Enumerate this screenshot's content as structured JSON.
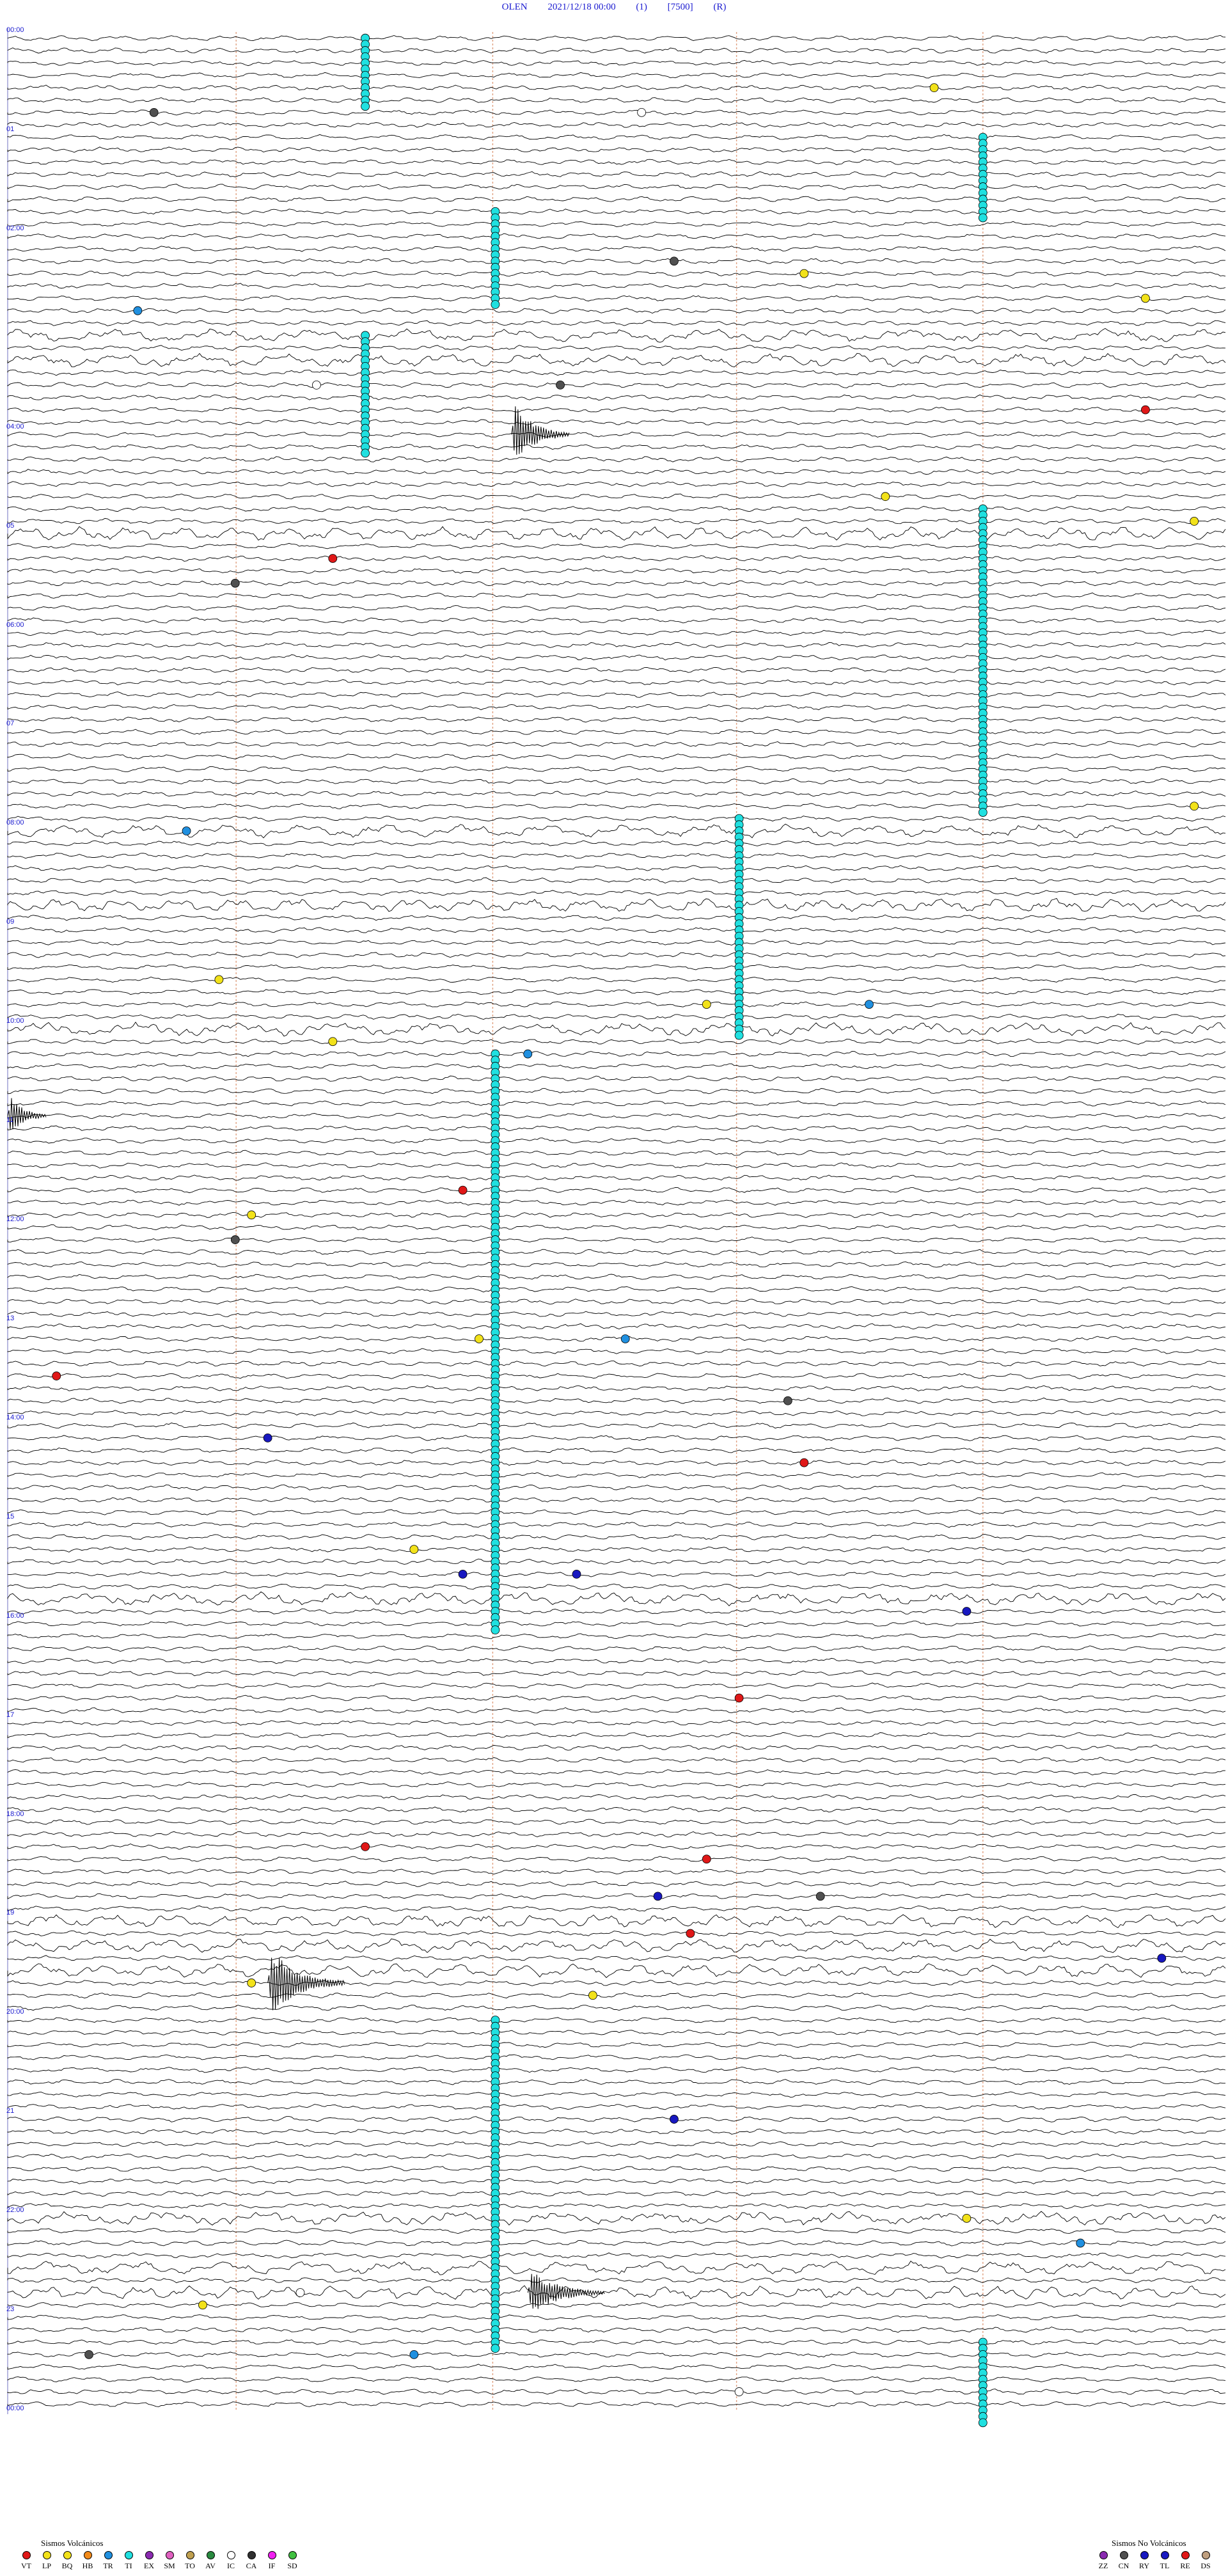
{
  "header": {
    "station": "OLEN",
    "datetime": "2021/12/18 00:00",
    "channel": "(1)",
    "gain": "[7500]",
    "flag": "(R)"
  },
  "legend_volcanic": {
    "title": "Sismos Volcánicos",
    "items": [
      {
        "code": "VT",
        "color": "#e01818"
      },
      {
        "code": "LP",
        "color": "#f2e21a"
      },
      {
        "code": "BQ",
        "color": "#f2e21a"
      },
      {
        "code": "HB",
        "color": "#f28a1a"
      },
      {
        "code": "TR",
        "color": "#2090e0"
      },
      {
        "code": "TI",
        "color": "#20e0e0"
      },
      {
        "code": "EX",
        "color": "#8a2ab0"
      },
      {
        "code": "SM",
        "color": "#e060c0"
      },
      {
        "code": "TO",
        "color": "#c0a050"
      },
      {
        "code": "AV",
        "color": "#2a8a40"
      },
      {
        "code": "IC",
        "color": "#ffffff"
      },
      {
        "code": "CA",
        "color": "#303030"
      },
      {
        "code": "IF",
        "color": "#f020f0"
      },
      {
        "code": "SD",
        "color": "#40c040"
      }
    ]
  },
  "legend_non_volcanic": {
    "title": "Sismos No Volcánicos",
    "items": [
      {
        "code": "ZZ",
        "color": "#8a2ab0"
      },
      {
        "code": "CN",
        "color": "#505050"
      },
      {
        "code": "RY",
        "color": "#1818c0"
      },
      {
        "code": "TL",
        "color": "#1818c0"
      },
      {
        "code": "RE",
        "color": "#e01818"
      },
      {
        "code": "DS",
        "color": "#c0a080"
      }
    ]
  },
  "chart_data": {
    "type": "line",
    "title": "OLEN 2021/12/18 00:00 (1) [7500] (R)",
    "time_labels": [
      {
        "row": 0,
        "label": "00:00"
      },
      {
        "row": 8,
        "label": "01"
      },
      {
        "row": 16,
        "label": "02:00"
      },
      {
        "row": 32,
        "label": "04:00"
      },
      {
        "row": 40,
        "label": "05"
      },
      {
        "row": 48,
        "label": "06:00"
      },
      {
        "row": 56,
        "label": "07"
      },
      {
        "row": 64,
        "label": "08:00"
      },
      {
        "row": 72,
        "label": "09"
      },
      {
        "row": 80,
        "label": "10:00"
      },
      {
        "row": 88,
        "label": "11"
      },
      {
        "row": 96,
        "label": "12:00"
      },
      {
        "row": 104,
        "label": "13"
      },
      {
        "row": 112,
        "label": "14:00"
      },
      {
        "row": 120,
        "label": "15"
      },
      {
        "row": 128,
        "label": "16:00"
      },
      {
        "row": 136,
        "label": "17"
      },
      {
        "row": 144,
        "label": "18:00"
      },
      {
        "row": 152,
        "label": "19"
      },
      {
        "row": 160,
        "label": "20:00"
      },
      {
        "row": 168,
        "label": "21"
      },
      {
        "row": 176,
        "label": "22:00"
      },
      {
        "row": 184,
        "label": "23"
      },
      {
        "row": 192,
        "label": "00:00"
      }
    ],
    "rows": 192,
    "minutes_per_row": 7.5,
    "tremor_columns": [
      {
        "code": "TI",
        "minute": 2.2,
        "row_start": 0,
        "row_end": 5
      },
      {
        "code": "TI",
        "minute": 2.2,
        "row_start": 24,
        "row_end": 33
      },
      {
        "code": "TI",
        "minute": 3.0,
        "row_start": 14,
        "row_end": 21
      },
      {
        "code": "TI",
        "minute": 3.0,
        "row_start": 82,
        "row_end": 128
      },
      {
        "code": "TI",
        "minute": 3.0,
        "row_start": 160,
        "row_end": 186
      },
      {
        "code": "TI",
        "minute": 4.5,
        "row_start": 63,
        "row_end": 80
      },
      {
        "code": "TI",
        "minute": 6.0,
        "row_start": 8,
        "row_end": 14
      },
      {
        "code": "TI",
        "minute": 6.0,
        "row_start": 38,
        "row_end": 62
      },
      {
        "code": "TI",
        "minute": 6.0,
        "row_start": 186,
        "row_end": 192
      }
    ],
    "events": [
      {
        "code": "VT",
        "row": 42,
        "minute": 2.0
      },
      {
        "code": "VT",
        "row": 93,
        "minute": 2.8
      },
      {
        "code": "VT",
        "row": 30,
        "minute": 7.0
      },
      {
        "code": "VT",
        "row": 108,
        "minute": 0.3
      },
      {
        "code": "VT",
        "row": 115,
        "minute": 4.9
      },
      {
        "code": "VT",
        "row": 134,
        "minute": 4.5
      },
      {
        "code": "VT",
        "row": 146,
        "minute": 2.2
      },
      {
        "code": "VT",
        "row": 147,
        "minute": 4.3
      },
      {
        "code": "VT",
        "row": 153,
        "minute": 4.2
      },
      {
        "code": "LP",
        "row": 4,
        "minute": 5.7
      },
      {
        "code": "LP",
        "row": 19,
        "minute": 4.9
      },
      {
        "code": "LP",
        "row": 21,
        "minute": 7.0
      },
      {
        "code": "LP",
        "row": 37,
        "minute": 5.4
      },
      {
        "code": "LP",
        "row": 39,
        "minute": 7.3
      },
      {
        "code": "LP",
        "row": 62,
        "minute": 7.3
      },
      {
        "code": "LP",
        "row": 76,
        "minute": 1.3
      },
      {
        "code": "LP",
        "row": 78,
        "minute": 4.3
      },
      {
        "code": "LP",
        "row": 81,
        "minute": 2.0
      },
      {
        "code": "LP",
        "row": 95,
        "minute": 1.5
      },
      {
        "code": "LP",
        "row": 105,
        "minute": 2.9
      },
      {
        "code": "LP",
        "row": 122,
        "minute": 2.5
      },
      {
        "code": "LP",
        "row": 157,
        "minute": 1.5
      },
      {
        "code": "LP",
        "row": 158,
        "minute": 3.6
      },
      {
        "code": "LP",
        "row": 176,
        "minute": 5.9
      },
      {
        "code": "LP",
        "row": 183,
        "minute": 1.2
      },
      {
        "code": "TR",
        "row": 22,
        "minute": 0.8
      },
      {
        "code": "TR",
        "row": 64,
        "minute": 1.1
      },
      {
        "code": "TR",
        "row": 78,
        "minute": 5.3
      },
      {
        "code": "TR",
        "row": 82,
        "minute": 3.2
      },
      {
        "code": "TR",
        "row": 105,
        "minute": 3.8
      },
      {
        "code": "TR",
        "row": 178,
        "minute": 6.6
      },
      {
        "code": "TR",
        "row": 187,
        "minute": 2.5
      },
      {
        "code": "RY",
        "row": 113,
        "minute": 1.6
      },
      {
        "code": "RY",
        "row": 124,
        "minute": 2.8
      },
      {
        "code": "RY",
        "row": 124,
        "minute": 3.5
      },
      {
        "code": "RY",
        "row": 127,
        "minute": 5.9
      },
      {
        "code": "RY",
        "row": 150,
        "minute": 4.0
      },
      {
        "code": "RY",
        "row": 155,
        "minute": 7.1
      },
      {
        "code": "RY",
        "row": 168,
        "minute": 4.1
      },
      {
        "code": "CN",
        "row": 6,
        "minute": 0.9
      },
      {
        "code": "CN",
        "row": 18,
        "minute": 4.1
      },
      {
        "code": "CN",
        "row": 28,
        "minute": 3.4
      },
      {
        "code": "CN",
        "row": 44,
        "minute": 1.4
      },
      {
        "code": "CN",
        "row": 97,
        "minute": 1.4
      },
      {
        "code": "CN",
        "row": 110,
        "minute": 4.8
      },
      {
        "code": "CN",
        "row": 150,
        "minute": 5.0
      },
      {
        "code": "CN",
        "row": 187,
        "minute": 0.5
      },
      {
        "code": "IC",
        "row": 6,
        "minute": 3.9
      },
      {
        "code": "IC",
        "row": 28,
        "minute": 1.9
      },
      {
        "code": "IC",
        "row": 182,
        "minute": 1.8
      },
      {
        "code": "IC",
        "row": 190,
        "minute": 4.5
      }
    ]
  }
}
